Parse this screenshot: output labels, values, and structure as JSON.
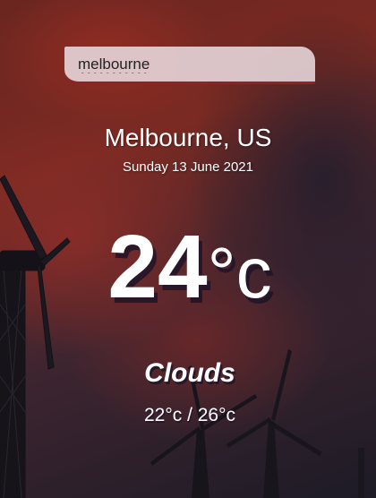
{
  "search": {
    "value": "melbourne"
  },
  "location": {
    "city_country": "Melbourne, US",
    "date": "Sunday 13 June 2021"
  },
  "current": {
    "temperature": "24",
    "unit": "°c",
    "condition": "Clouds",
    "hi_low": "22°c / 26°c"
  },
  "colors": {
    "accent": "#8e2424",
    "text": "#ffffff"
  }
}
